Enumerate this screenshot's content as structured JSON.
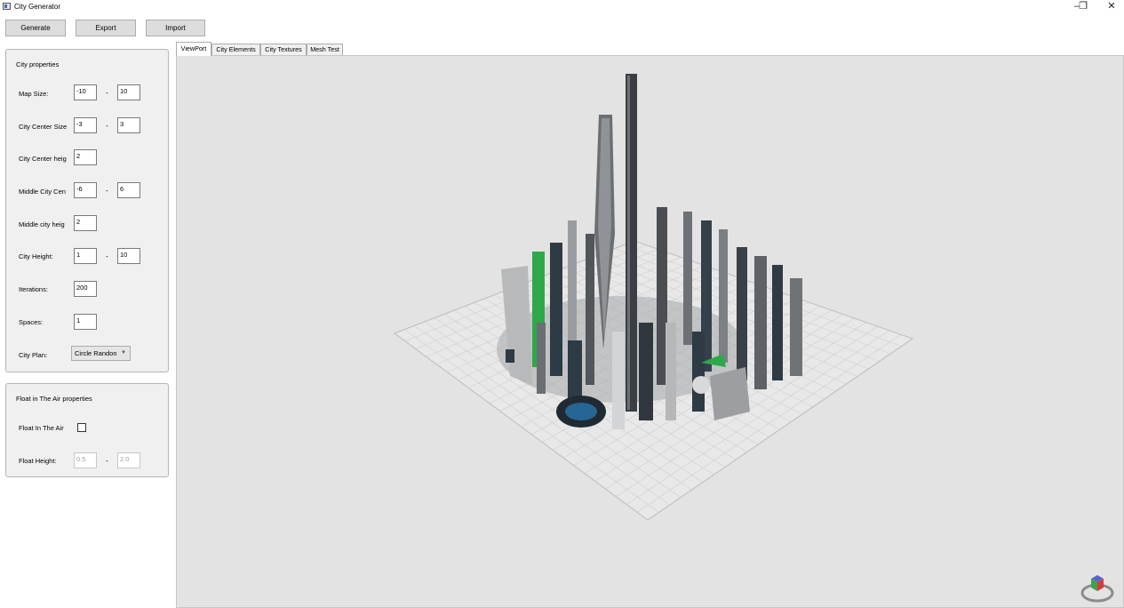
{
  "window": {
    "title": "City Generator",
    "minimize": "–",
    "restore": "❐",
    "close": "✕"
  },
  "toolbar": {
    "generate": "Generate",
    "export": "Export",
    "import": "Import"
  },
  "city_properties": {
    "title": "City properties",
    "map_size": {
      "label": "Map Size:",
      "min": "-10",
      "max": "10"
    },
    "city_center_size": {
      "label": "City Center Size",
      "min": "-3",
      "max": "3"
    },
    "city_center_height": {
      "label": "City Center heig",
      "value": "2"
    },
    "middle_city_center": {
      "label": "Middle City Cen",
      "min": "-6",
      "max": "6"
    },
    "middle_city_height": {
      "label": "Middle city heig",
      "value": "2"
    },
    "city_height": {
      "label": "City Height:",
      "min": "1",
      "max": "10"
    },
    "iterations": {
      "label": "Iterations:",
      "value": "200"
    },
    "spaces": {
      "label": "Spaces:",
      "value": "1"
    },
    "city_plan": {
      "label": "City Plan:",
      "selected": "Circle Randon"
    },
    "range_separator": "-"
  },
  "float_properties": {
    "title": "Float in The Air properties",
    "float_in_air": {
      "label": "Float In The Air",
      "checked": false
    },
    "float_height": {
      "label": "Float Height:",
      "min": "0.5",
      "max": "2.0"
    }
  },
  "tabs": [
    {
      "label": "ViewPort",
      "active": true
    },
    {
      "label": "City Elements",
      "active": false
    },
    {
      "label": "City Textures",
      "active": false
    },
    {
      "label": "Mesh Test",
      "active": false
    }
  ],
  "colors": {
    "viewport_bg": "#e3e3e3",
    "building_dark": "#2e3a44",
    "building_gray": "#8a8d90",
    "accent_green": "#2fa84a",
    "accent_blue": "#2a8fd6"
  }
}
